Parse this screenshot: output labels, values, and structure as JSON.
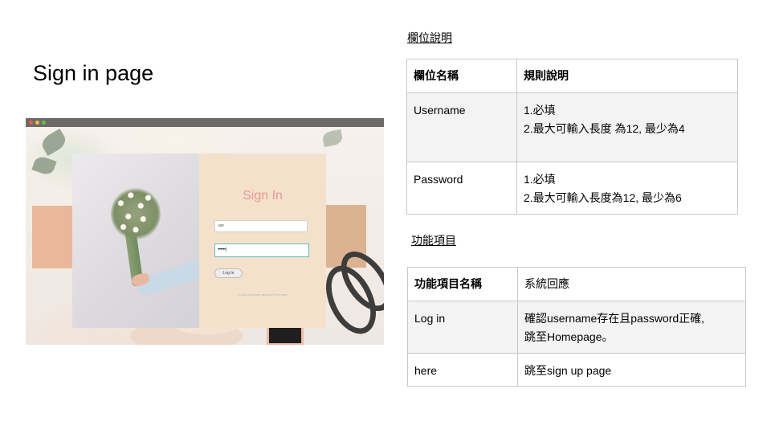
{
  "page": {
    "title": "Sign in page"
  },
  "mockup": {
    "window_buttons": [
      "close",
      "minimize",
      "maximize"
    ],
    "form": {
      "title": "Sign In",
      "username_value": "ian",
      "password_value": "••••••|",
      "login_label": "Log In",
      "signup_text": "If you dont have account  Pick here"
    },
    "colors": {
      "title": "#e5989b",
      "panel": "#f5e1cb",
      "focus": "#5bc0c7"
    }
  },
  "fields_section": {
    "heading": "欄位說明",
    "columns": [
      "欄位名稱",
      "規則說明"
    ],
    "rows": [
      {
        "name": "Username",
        "rules": [
          "1.必填",
          "2.最大可輸入長度  為12, 最少為4"
        ]
      },
      {
        "name": "Password",
        "rules": [
          "1.必填",
          "2.最大可輸入長度為12,   最少為6"
        ]
      }
    ]
  },
  "functions_section": {
    "heading": "功能項目",
    "columns": [
      "功能項目名稱",
      "系統回應"
    ],
    "rows": [
      {
        "name": "Log in",
        "response": [
          "確認username存在且password正確,",
          "跳至Homepage。"
        ]
      },
      {
        "name": "here",
        "response": [
          "跳至sign up page"
        ]
      }
    ]
  }
}
